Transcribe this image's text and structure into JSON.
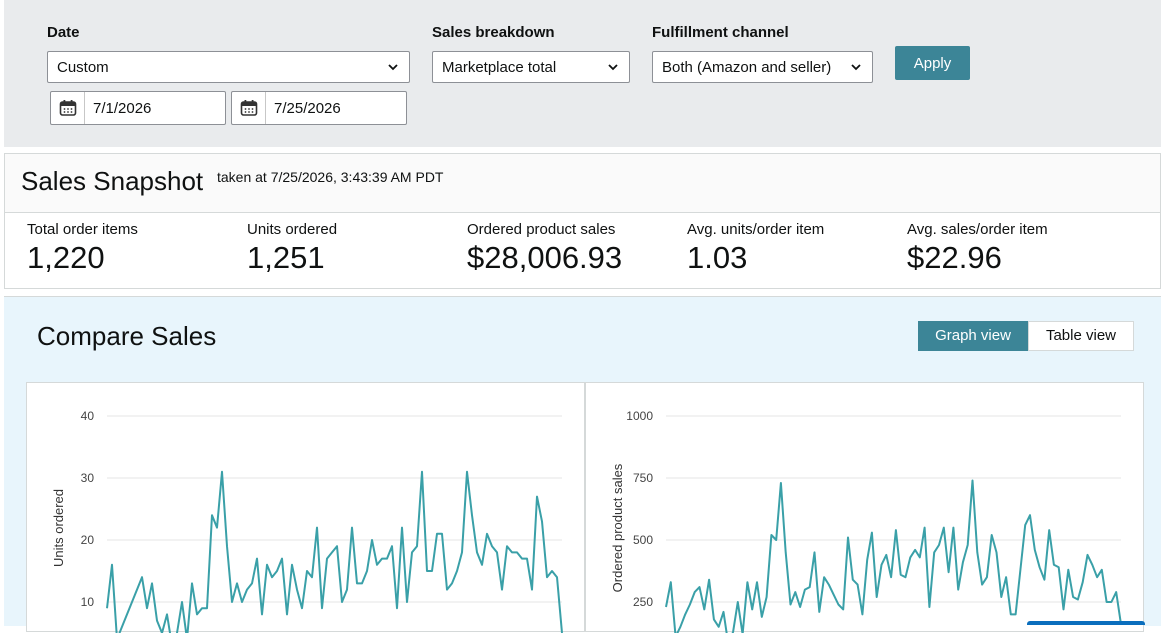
{
  "filters": {
    "date_label": "Date",
    "date_select": "Custom",
    "start_date": "7/1/2026",
    "end_date": "7/25/2026",
    "breakdown_label": "Sales breakdown",
    "breakdown_select": "Marketplace total",
    "channel_label": "Fulfillment channel",
    "channel_select": "Both (Amazon and seller)",
    "apply_label": "Apply"
  },
  "snapshot": {
    "title": "Sales Snapshot",
    "taken_at": "taken at 7/25/2026, 3:43:39 AM PDT",
    "metrics": [
      {
        "label": "Total order items",
        "value": "1,220"
      },
      {
        "label": "Units ordered",
        "value": "1,251"
      },
      {
        "label": "Ordered product sales",
        "value": "$28,006.93"
      },
      {
        "label": "Avg. units/order item",
        "value": "1.03"
      },
      {
        "label": "Avg. sales/order item",
        "value": "$22.96"
      }
    ]
  },
  "compare": {
    "title": "Compare Sales",
    "graph_view_label": "Graph view",
    "table_view_label": "Table view"
  },
  "colors": {
    "accent": "#3c8597",
    "line": "#3aa0a8"
  },
  "chart_data": [
    {
      "type": "line",
      "title": "",
      "ylabel": "Units ordered",
      "xlabel": "",
      "ylim": [
        0,
        40
      ],
      "yticks": [
        "10",
        "20",
        "30",
        "40"
      ],
      "grid": true,
      "series": [
        {
          "values": [
            9,
            16,
            4,
            6,
            8,
            10,
            12,
            14,
            9,
            13,
            7,
            5,
            8,
            3,
            5,
            10,
            4,
            13,
            8,
            9,
            9,
            24,
            22,
            31,
            19,
            10,
            13,
            10,
            12,
            13,
            17,
            8,
            16,
            14,
            15,
            17,
            8,
            16,
            12,
            9,
            15,
            14,
            22,
            9,
            17,
            18,
            19,
            10,
            12,
            22,
            13,
            13,
            15,
            20,
            16,
            17,
            17,
            19,
            9,
            22,
            10,
            18,
            19,
            31,
            15,
            15,
            21,
            21,
            12,
            13,
            15,
            18,
            31,
            24,
            18,
            16,
            21,
            19,
            18,
            12,
            19,
            18,
            18,
            17,
            17,
            12,
            27,
            23,
            14,
            15,
            14,
            5
          ]
        }
      ]
    },
    {
      "type": "line",
      "title": "",
      "ylabel": "Ordered product sales",
      "xlabel": "",
      "ylim": [
        0,
        1000
      ],
      "yticks": [
        "250",
        "500",
        "750",
        "1000"
      ],
      "grid": true,
      "series": [
        {
          "values": [
            230,
            330,
            110,
            150,
            200,
            240,
            290,
            310,
            220,
            340,
            180,
            150,
            210,
            80,
            130,
            250,
            120,
            330,
            220,
            330,
            190,
            270,
            520,
            500,
            730,
            450,
            240,
            290,
            230,
            300,
            310,
            450,
            210,
            350,
            320,
            280,
            240,
            220,
            510,
            340,
            320,
            200,
            420,
            530,
            270,
            400,
            440,
            350,
            540,
            360,
            350,
            430,
            460,
            430,
            550,
            230,
            450,
            480,
            550,
            370,
            550,
            300,
            410,
            480,
            740,
            450,
            320,
            350,
            520,
            450,
            270,
            350,
            200,
            200,
            380,
            560,
            600,
            460,
            390,
            340,
            540,
            400,
            390,
            220,
            380,
            270,
            260,
            330,
            440,
            400,
            350,
            380,
            250,
            250,
            290,
            160
          ]
        }
      ]
    }
  ]
}
